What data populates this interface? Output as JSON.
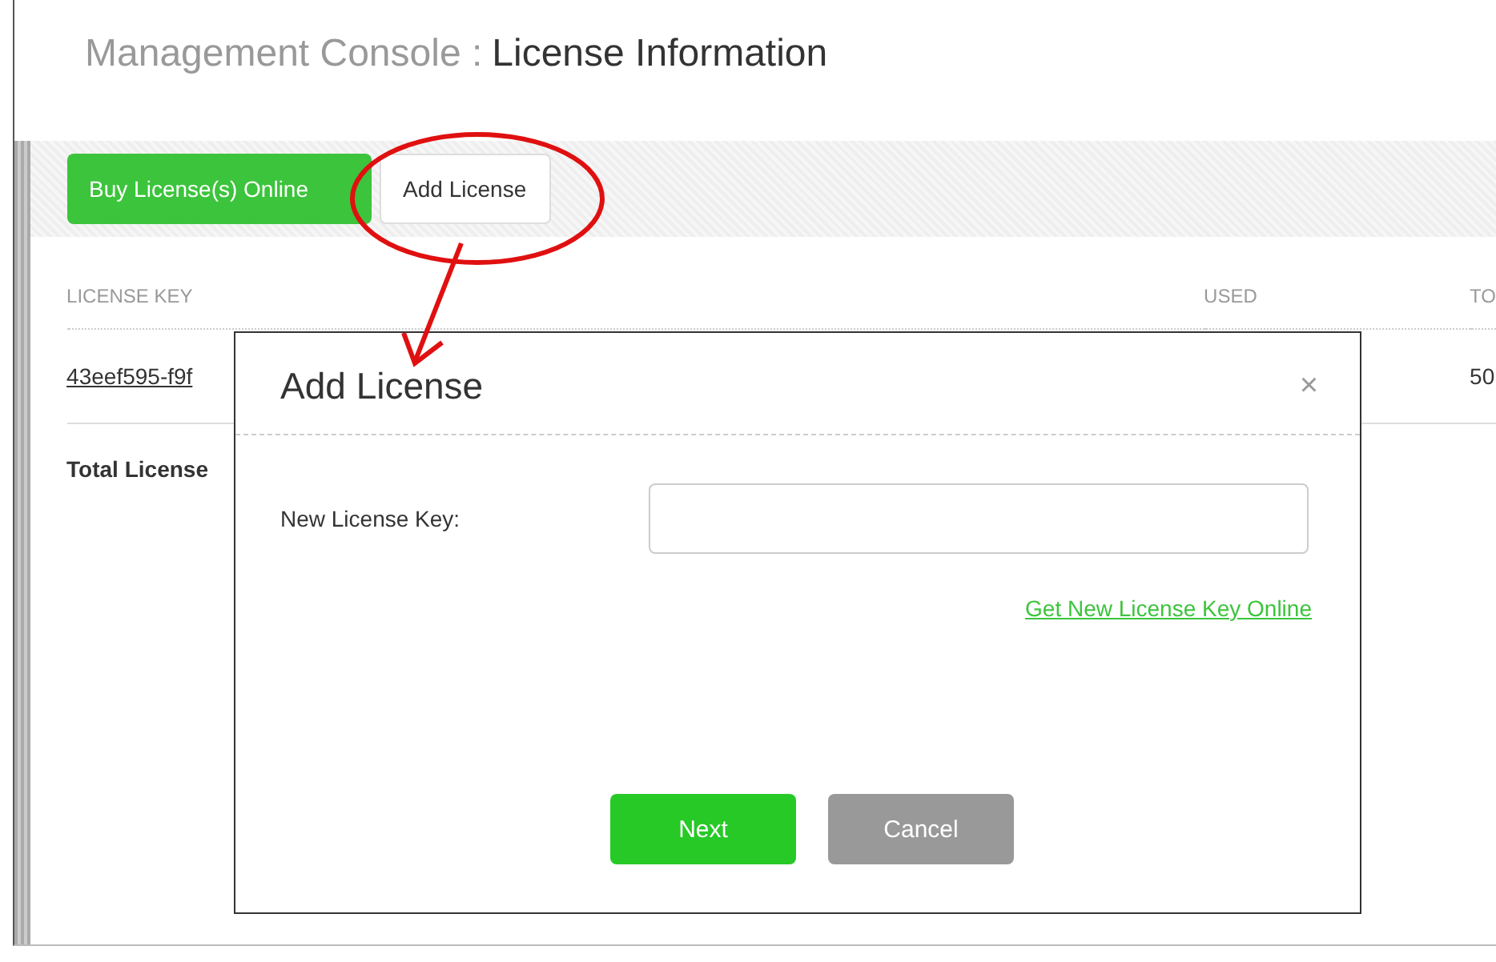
{
  "header": {
    "section": "Management Console :",
    "title": "License Information"
  },
  "toolbar": {
    "buttons": [
      {
        "label": "Buy License(s) Online",
        "kind": "primary"
      },
      {
        "label": "Add License",
        "kind": "plain"
      }
    ]
  },
  "table": {
    "columns": [
      "LICENSE KEY",
      "USED",
      "TO"
    ],
    "rows": [
      [
        "43eef595-f9f",
        "",
        "50"
      ]
    ],
    "total": "Total License"
  },
  "dialog": {
    "title": "Add License",
    "close": "×",
    "field_label": "New License Key:",
    "link": "Get New License Key Online",
    "buttons": [
      {
        "label": "Next",
        "kind": "primary"
      },
      {
        "label": "Cancel",
        "kind": "secondary"
      }
    ]
  }
}
